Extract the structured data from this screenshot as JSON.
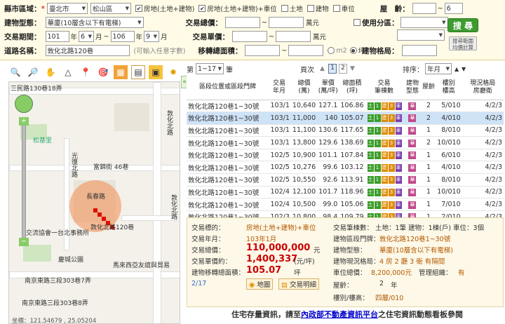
{
  "filters": {
    "county_label": "縣市區域：",
    "county": "臺北市",
    "district": "松山區",
    "types": [
      {
        "label": "房地(土地+建物)",
        "checked": true
      },
      {
        "label": "房地(土地+建物)+車位",
        "checked": true
      },
      {
        "label": "土地",
        "checked": false
      },
      {
        "label": "建物",
        "checked": false
      },
      {
        "label": "車位",
        "checked": false
      }
    ],
    "age_label": "屋　齡：",
    "age_to": "6",
    "age_sep": "~",
    "building_type_label": "建物型態：",
    "building_type": "華廈(10層含以下有電梯)",
    "total_price_label": "交易總價：",
    "total_unit": "萬元",
    "unit_price_label": "交易單價：",
    "unit_unit": "萬元",
    "use_zone_label": "使用分區：",
    "period_label": "交易期間：",
    "period_from_year": "101",
    "period_from_month": "6",
    "period_to_year": "106",
    "period_to_month": "9",
    "year_unit": "年",
    "month_unit": "月",
    "area_label": "移轉總面積：",
    "area_unit_m2": "m2",
    "area_unit_ping": "坪",
    "road_label": "道路名稱：",
    "road": "敦化北路120巷",
    "road_hint": "(可輸入任意字數)",
    "layout_label": "建物格局：",
    "search_button": "搜 尋",
    "agg_button": "搜尋範圍\n均價計算"
  },
  "map": {
    "labels": [
      "三民路130巷18弄",
      "敦化北路",
      "富錦街 46巷",
      "光復北路",
      "長春路",
      "敦化北路120巷",
      "交流協會一台北事務所",
      "慶城公園",
      "馬來西亞友誼與貿易",
      "南京東路三段303巷7弄",
      "南京東路三段303巷8弄",
      "松基里",
      "敦化北路"
    ],
    "coords": "坐標：121.54679 , 25.05204"
  },
  "results": {
    "per_page_label": "第",
    "per_page": "1~17",
    "per_page_unit": "筆",
    "page_label": "頁次",
    "pages": [
      "1",
      "2"
    ],
    "sort_label": "排序：",
    "sort": "年月",
    "headers": [
      "區段位置或區段門牌",
      "交易\n年月",
      "總價\n(萬)",
      "單價\n(萬/坪)",
      "總面積\n(坪)",
      "交易\n筆棟數",
      "建物\n型態",
      "屋齡",
      "樓別\n樓高",
      "現況格局\n房廳衛"
    ],
    "rows": [
      {
        "loc": "敦化北路120巷1~30號",
        "ym": "103/1",
        "total": "10,640",
        "unit": "127.1",
        "area": "106.86",
        "age": "2",
        "floor": "5/010",
        "layout": "4/2/3",
        "selected": false
      },
      {
        "loc": "敦化北路120巷1~30號",
        "ym": "103/1",
        "total": "11,000",
        "unit": "140",
        "area": "105.07",
        "age": "2",
        "floor": "4/010",
        "layout": "4/2/3",
        "selected": true
      },
      {
        "loc": "敦化北路120巷1~30號",
        "ym": "103/1",
        "total": "11,100",
        "unit": "130.6",
        "area": "117.65",
        "age": "1",
        "floor": "8/010",
        "layout": "4/2/3",
        "selected": false
      },
      {
        "loc": "敦化北路120巷1~30號",
        "ym": "103/1",
        "total": "13,800",
        "unit": "129.6",
        "area": "138.69",
        "age": "2",
        "floor": "10/010",
        "layout": "4/2/3",
        "selected": false
      },
      {
        "loc": "敦化北路120巷1~30號",
        "ym": "102/5",
        "total": "10,900",
        "unit": "101.1",
        "area": "107.84",
        "age": "1",
        "floor": "6/010",
        "layout": "4/2/3",
        "selected": false
      },
      {
        "loc": "敦化北路120巷1~30號",
        "ym": "102/5",
        "total": "10,276",
        "unit": "99.6",
        "area": "103.12",
        "age": "1",
        "floor": "4/010",
        "layout": "4/2/3",
        "selected": false
      },
      {
        "loc": "敦化北路120巷1~30號",
        "ym": "102/5",
        "total": "10,550",
        "unit": "92.6",
        "area": "113.91",
        "age": "1",
        "floor": "8/010",
        "layout": "4/2/3",
        "selected": false
      },
      {
        "loc": "敦化北路120巷1~30號",
        "ym": "102/4",
        "total": "12,100",
        "unit": "101.7",
        "area": "118.96",
        "age": "1",
        "floor": "10/010",
        "layout": "4/2/3",
        "selected": false
      },
      {
        "loc": "敦化北路120巷1~30號",
        "ym": "102/4",
        "total": "10,500",
        "unit": "99.0",
        "area": "105.06",
        "age": "1",
        "floor": "7/010",
        "layout": "4/2/3",
        "selected": false
      },
      {
        "loc": "敦化北路120巷1~30號",
        "ym": "102/3",
        "total": "10,800",
        "unit": "98.4",
        "area": "109.79",
        "age": "1",
        "floor": "2/010",
        "layout": "4/2/3",
        "selected": false
      }
    ],
    "tags": [
      "土",
      "1",
      "建",
      "3",
      "車"
    ],
    "type_tag": "華",
    "colors": {
      "land": "#3a9d2a",
      "build": "#e08a00",
      "car": "#7a3fb0",
      "type": "#c04a8a"
    }
  },
  "detail": {
    "subject_label": "交易標的：",
    "subject": "房地(土地+建物)+車位",
    "ym_label": "交易年月：",
    "ym": "103年1月",
    "total_label": "交易總價：",
    "total": "110,000,000",
    "total_unit": "元",
    "unit_label": "交易單價約：",
    "unit": "1,400,337",
    "unit_unit": "(元/坪)",
    "area_label": "建物移轉總面積：",
    "area": "105.07",
    "area_unit": "坪",
    "index": "2/17",
    "map_btn": "地圖",
    "detail_btn": "交易明細",
    "count_label": "交易筆棟數：",
    "count": "土地：1筆 建物：1棟(戶) 車位：3個",
    "addr_label": "建物區段門牌：",
    "addr": "敦化北路120巷1~30號",
    "type_label": "建物型態：",
    "type": "華廈(10層含以下有電梯)",
    "layout_label": "建物現況格局：",
    "layout": "4 房 2 廳 3 衛  有隔間",
    "car_label": "車位總價：",
    "car_total": "8,200,000元",
    "mgmt_label": "管理組織：",
    "mgmt": "有",
    "age_label": "屋齡：",
    "age": "2",
    "age_unit": "年",
    "floor_label": "樓別/樓高：",
    "floor": "四層/010"
  },
  "footer": {
    "text_before": "住宅存量資訊，請至",
    "link": "內政部不動產資訊平台",
    "text_after": "之住宅資訊動態看板參閱"
  }
}
